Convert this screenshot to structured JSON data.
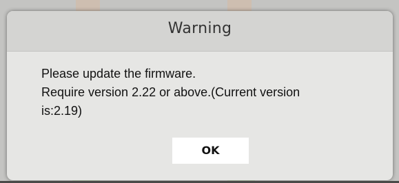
{
  "dialog": {
    "title": "Warning",
    "message_lines": [
      "Please update the firmware.",
      "Require version 2.22 or above.(Current version",
      "is:2.19)"
    ],
    "ok_label": "OK"
  },
  "colors": {
    "dialog_bg": "#e6e6e4",
    "header_bg": "#d4d4d2",
    "ok_button_bg": "#ffffff",
    "text": "#111111"
  }
}
